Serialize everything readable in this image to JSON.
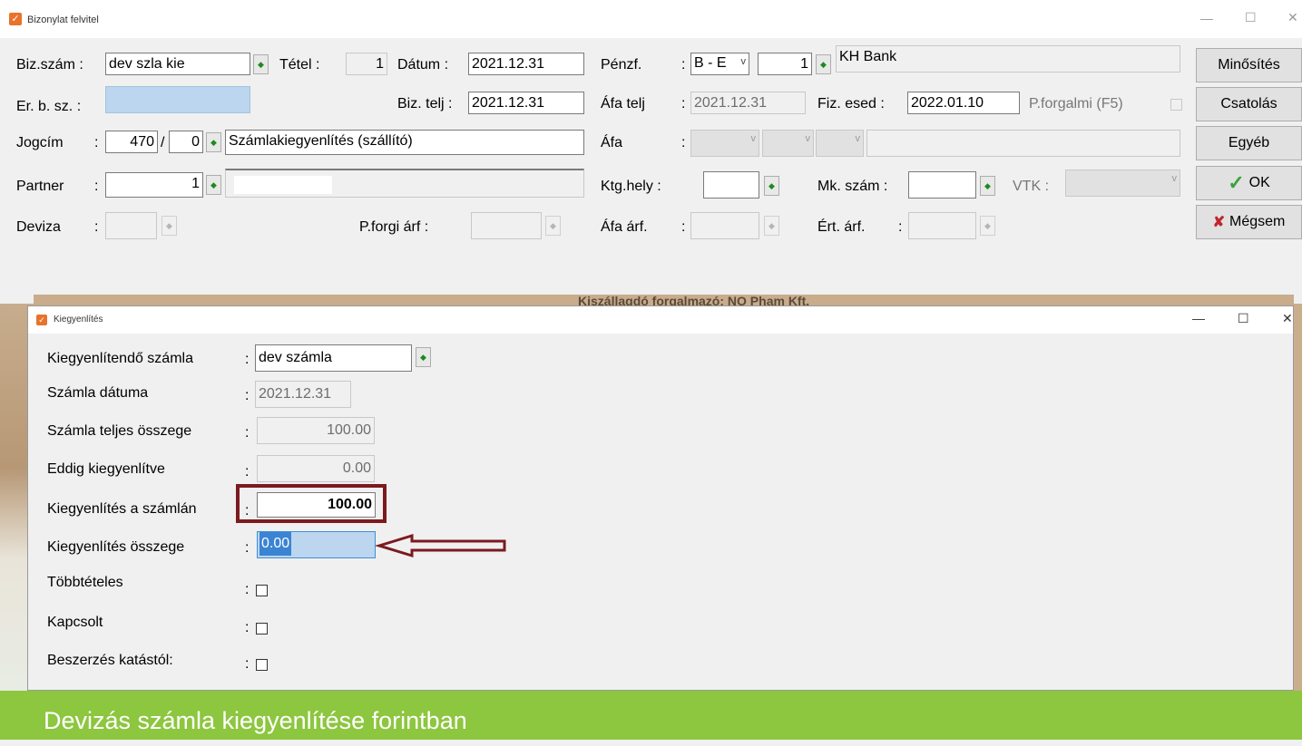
{
  "main": {
    "title": "Bizonylat felvitel",
    "fields": {
      "bizszam_label": "Biz.szám :",
      "bizszam_value": "dev szla kie",
      "tetel_label": "Tétel :",
      "tetel_value": "1",
      "datum_label": "Dátum :",
      "datum_value": "2021.12.31",
      "penzf_label": "Pénzf.",
      "penzf_colon": ":",
      "penzf_select": "B - E",
      "penzf_num": "1",
      "penzf_name": "KH Bank",
      "erbsz_label": "Er. b. sz. :",
      "bizteljs_label": "Biz. telj :",
      "bizteljs_value": "2021.12.31",
      "afatelj_label": "Áfa telj",
      "afatelj_colon": ":",
      "afatelj_value": "2021.12.31",
      "fizesed_label": "Fiz. esed :",
      "fizesed_value": "2022.01.10",
      "pforgalmi_label": "P.forgalmi (F5)",
      "jogcim_label": "Jogcím",
      "jogcim_colon": ":",
      "jogcim_main": "470",
      "jogcim_slash": "/",
      "jogcim_sub": "0",
      "jogcim_text": "Számlakiegyenlítés (szállító)",
      "afa_label": "Áfa",
      "afa_colon": ":",
      "partner_label": "Partner",
      "partner_colon": ":",
      "partner_value": "1",
      "ktghely_label": "Ktg.hely :",
      "mkszam_label": "Mk. szám :",
      "vtk_label": "VTK :",
      "deviza_label": "Deviza",
      "deviza_colon": ":",
      "pforgiarf_label": "P.forgi árf :",
      "afaarf_label": "Áfa árf.",
      "afaarf_colon": ":",
      "ertarf_label": "Ért. árf.",
      "ertarf_colon": ":"
    },
    "buttons": {
      "minosites": "Minősítés",
      "csatolas": "Csatolás",
      "egyeb": "Egyéb",
      "ok": "OK",
      "megsem": "Mégsem"
    }
  },
  "dialog": {
    "title": "Kiegyenlítés",
    "rows": {
      "r1_label": "Kiegyenlítendő számla",
      "r1_value": "dev számla",
      "r2_label": "Számla dátuma",
      "r2_value": "2021.12.31",
      "r3_label": "Számla teljes összege",
      "r3_value": "100.00",
      "r4_label": "Eddig kiegyenlítve",
      "r4_value": "0.00",
      "r5_label": "Kiegyenlítés a számlán",
      "r5_value": "100.00",
      "r6_label": "Kiegyenlítés összege",
      "r6_value": "0.00",
      "r7_label": "Többtételes",
      "r8_label": "Kapcsolt",
      "r9_label": "Beszerzés katástól:"
    },
    "colon": ":"
  },
  "background_text": "Kiszállagdó forgalmazó: NO Pham Kft.",
  "banner": {
    "text": "Devizás számla kiegyenlítése forintban"
  },
  "colors": {
    "highlight_box": "#7b1a1f",
    "arrow": "#7b1a1f",
    "banner": "#8dc63f",
    "selection": "#99c9ef"
  }
}
